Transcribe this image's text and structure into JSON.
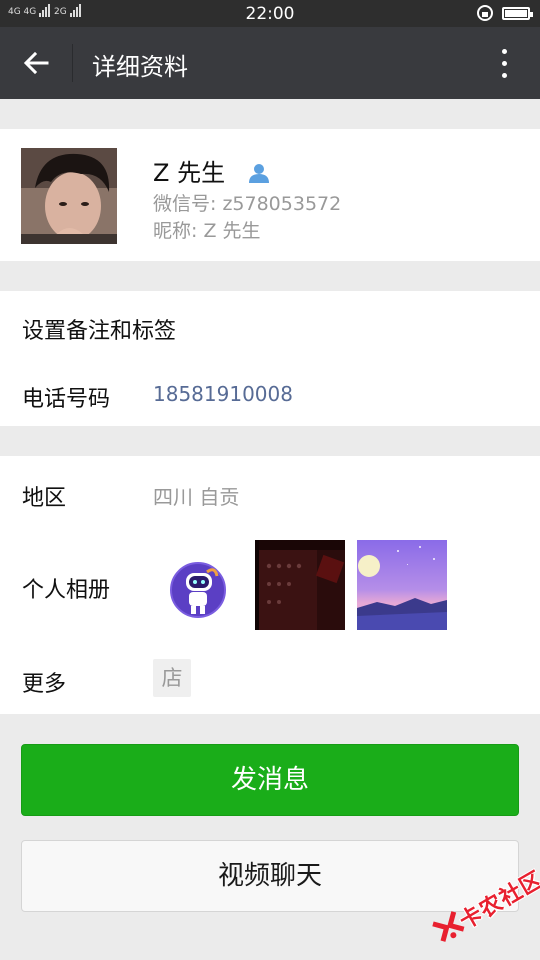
{
  "status_bar": {
    "network_1": "4G 4G",
    "network_2": "2G",
    "time": "22:00"
  },
  "title_bar": {
    "title": "详细资料",
    "back_icon": "arrow-left-icon",
    "more_icon": "more-vertical-icon"
  },
  "profile": {
    "name": "Z 先生",
    "contact_icon": "person-icon",
    "wechat_id": "微信号: z578053572",
    "nickname": "昵称: Z 先生"
  },
  "rows": {
    "remark_tags": "设置备注和标签",
    "phone_label": "电话号码",
    "phone_value": "18581910008",
    "region_label": "地区",
    "region_value": "四川  自贡",
    "album_label": "个人相册",
    "more_label": "更多",
    "store_icon": "店"
  },
  "buttons": {
    "send_message": "发消息",
    "video_chat": "视频聊天"
  },
  "watermark": {
    "text": "卡农社区"
  },
  "colors": {
    "accent_green": "#1aad19",
    "title_bar": "#393a3e",
    "phone_link": "#576b95",
    "watermark_red": "#e8202f"
  }
}
